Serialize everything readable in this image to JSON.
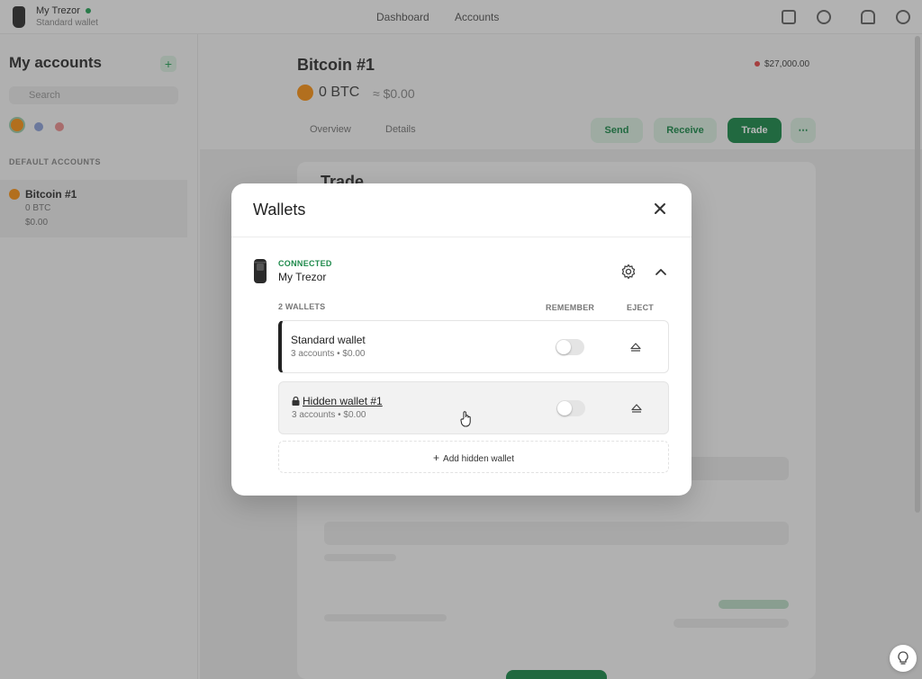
{
  "app": {
    "device_name": "My Trezor",
    "device_sub": "Standard wallet",
    "nav": {
      "dashboard": "Dashboard",
      "accounts": "Accounts"
    }
  },
  "sidebar": {
    "title": "My accounts",
    "search_placeholder": "Search",
    "section": "DEFAULT ACCOUNTS",
    "account": {
      "name": "Bitcoin #1",
      "crypto": "0 BTC",
      "fiat": "$0.00"
    }
  },
  "main": {
    "title": "Bitcoin #1",
    "balance": "0 BTC",
    "fiat": "≈ $0.00",
    "tabs": [
      "Overview",
      "Details"
    ],
    "buttons": {
      "send": "Send",
      "receive": "Receive",
      "trade": "Trade"
    },
    "badge": "$27,000.00",
    "trade_title": "Trade"
  },
  "modal": {
    "title": "Wallets",
    "device": {
      "status": "CONNECTED",
      "name": "My Trezor"
    },
    "headers": {
      "wallets": "2 WALLETS",
      "remember": "REMEMBER",
      "eject": "EJECT"
    },
    "wallets": [
      {
        "name": "Standard wallet",
        "sub": "3 accounts • $0.00",
        "remember": false
      },
      {
        "name": "Hidden wallet #1",
        "sub": "3 accounts • $0.00",
        "remember": false
      }
    ],
    "add_hidden_label": "Add hidden wallet"
  },
  "icons": {
    "close": "close-icon",
    "settings": "gear-icon",
    "collapse": "chevron-up-icon",
    "eject": "eject-icon",
    "lock": "lock-icon",
    "add": "plus-icon"
  },
  "colors": {
    "accent": "#1f8a4c",
    "connected": "#1f8a4c",
    "overlay": "rgba(40,40,40,0.33)"
  }
}
